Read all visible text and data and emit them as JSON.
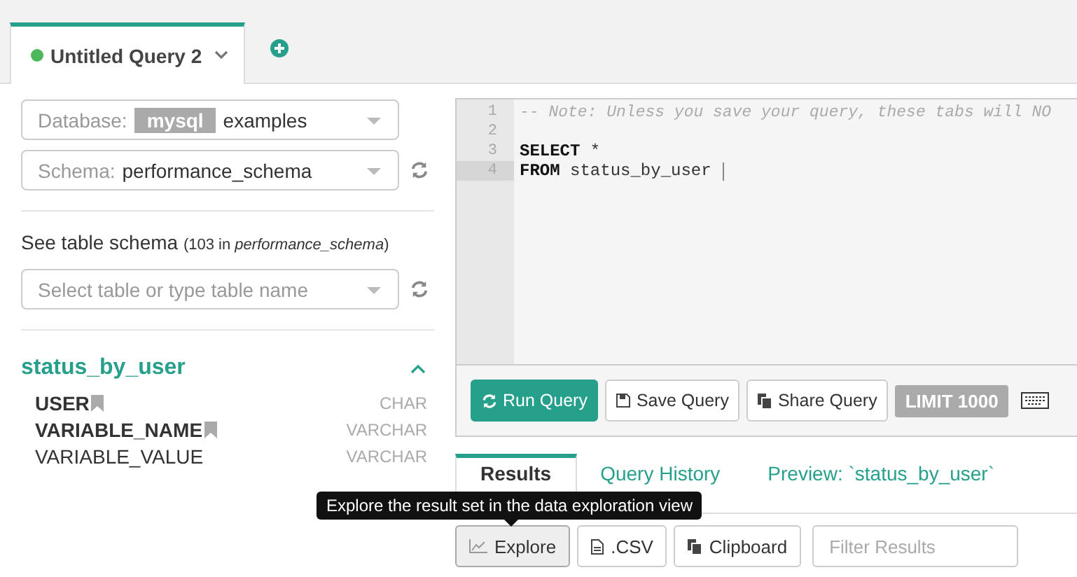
{
  "query_tabs": [
    {
      "label": "Untitled Query 2",
      "selected": true
    }
  ],
  "database_select": {
    "label": "Database:",
    "engine": "mysql",
    "value": "examples"
  },
  "schema_select": {
    "label": "Schema:",
    "value": "performance_schema"
  },
  "table_schema": {
    "heading": "See table schema",
    "count_note": "(103 in *performance_schema*)",
    "placeholder": "Select table or type table name"
  },
  "table": {
    "name": "status_by_user",
    "expanded": true,
    "columns": [
      {
        "name": "USER",
        "type": "CHAR",
        "key": true
      },
      {
        "name": "VARIABLE_NAME",
        "type": "VARCHAR",
        "key": true
      },
      {
        "name": "VARIABLE_VALUE",
        "type": "VARCHAR",
        "key": false
      }
    ]
  },
  "editor": {
    "lines": [
      {
        "number": "1",
        "kind": "comment",
        "text": "-- Note: Unless you save your query, these tabs will NO",
        "selected": false
      },
      {
        "number": "2",
        "kind": "blank",
        "selected": false
      },
      {
        "number": "3",
        "kind": "code",
        "keyword": "SELECT",
        "text": " *",
        "selected": false
      },
      {
        "number": "4",
        "kind": "code",
        "keyword": "FROM",
        "text": " status_by_user",
        "selected": true
      }
    ]
  },
  "toolbar": {
    "run": "Run Query",
    "save": "Save Query",
    "share": "Share Query",
    "limit": "LIMIT 1000"
  },
  "result_tabs": [
    {
      "label": "Results",
      "selected": true
    },
    {
      "label": "Query History",
      "selected": false
    },
    {
      "label": "Preview: `status_by_user`",
      "selected": false
    }
  ],
  "tooltip": "Explore the result set in the data exploration view",
  "result_actions": {
    "explore": "Explore",
    "csv": ".CSV",
    "clipboard": "Clipboard",
    "filter_placeholder": "Filter Results"
  }
}
